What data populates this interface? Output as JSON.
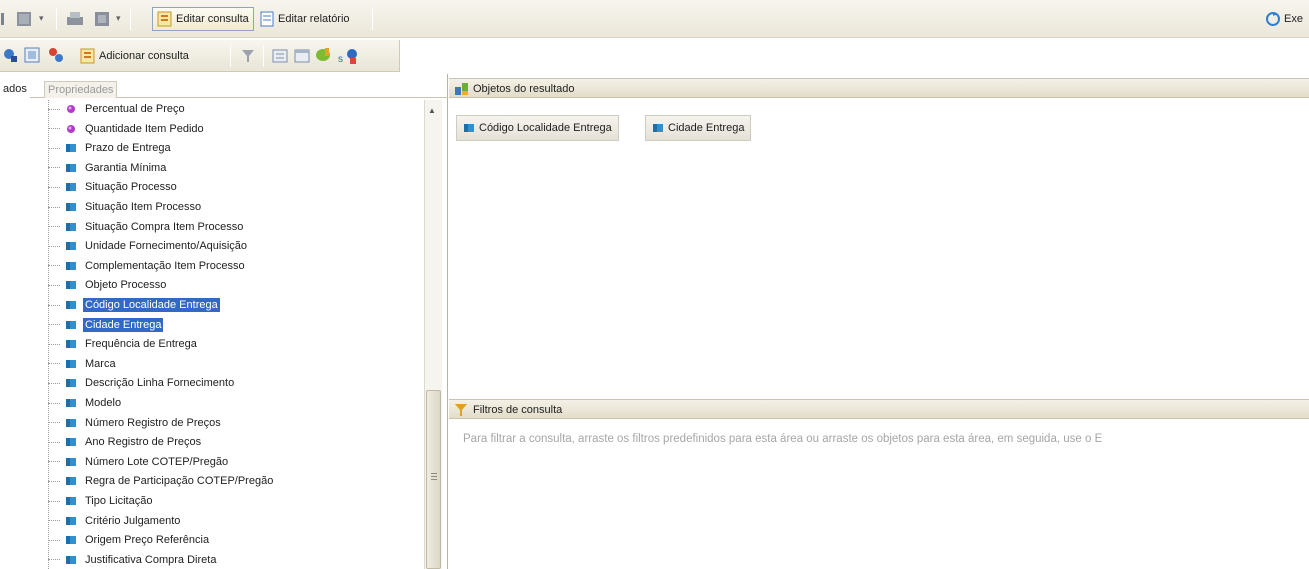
{
  "toolbar": {
    "edit_query_label": "Editar consulta",
    "edit_report_label": "Editar relatório",
    "execute_label": "Exe",
    "add_query_label": "Adicionar consulta"
  },
  "left_panel": {
    "tab_data": "ados",
    "tab_properties": "Propriedades",
    "items": [
      {
        "label": "Percentual de Preço",
        "icon": "measure-icon",
        "selected": false
      },
      {
        "label": "Quantidade Item Pedido",
        "icon": "measure-icon",
        "selected": false
      },
      {
        "label": "Prazo de Entrega",
        "icon": "dimension-icon",
        "selected": false
      },
      {
        "label": "Garantia Mínima",
        "icon": "dimension-icon",
        "selected": false
      },
      {
        "label": "Situação Processo",
        "icon": "dimension-icon",
        "selected": false
      },
      {
        "label": "Situação Item Processo",
        "icon": "dimension-icon",
        "selected": false
      },
      {
        "label": "Situação Compra Item Processo",
        "icon": "dimension-icon",
        "selected": false
      },
      {
        "label": "Unidade Fornecimento/Aquisição",
        "icon": "dimension-icon",
        "selected": false
      },
      {
        "label": "Complementação Item Processo",
        "icon": "dimension-icon",
        "selected": false
      },
      {
        "label": "Objeto Processo",
        "icon": "dimension-icon",
        "selected": false
      },
      {
        "label": "Código Localidade Entrega",
        "icon": "dimension-icon",
        "selected": true
      },
      {
        "label": "Cidade Entrega",
        "icon": "dimension-icon",
        "selected": true
      },
      {
        "label": "Frequência de Entrega",
        "icon": "dimension-icon",
        "selected": false
      },
      {
        "label": "Marca",
        "icon": "dimension-icon",
        "selected": false
      },
      {
        "label": "Descrição Linha Fornecimento",
        "icon": "dimension-icon",
        "selected": false
      },
      {
        "label": "Modelo",
        "icon": "dimension-icon",
        "selected": false
      },
      {
        "label": "Número Registro de Preços",
        "icon": "dimension-icon",
        "selected": false
      },
      {
        "label": "Ano Registro de Preços",
        "icon": "dimension-icon",
        "selected": false
      },
      {
        "label": "Número Lote COTEP/Pregão",
        "icon": "dimension-icon",
        "selected": false
      },
      {
        "label": "Regra de Participação COTEP/Pregão",
        "icon": "dimension-icon",
        "selected": false
      },
      {
        "label": "Tipo Licitação",
        "icon": "dimension-icon",
        "selected": false
      },
      {
        "label": "Critério Julgamento",
        "icon": "dimension-icon",
        "selected": false
      },
      {
        "label": "Origem Preço Referência",
        "icon": "dimension-icon",
        "selected": false
      },
      {
        "label": "Justificativa Compra Direta",
        "icon": "dimension-icon",
        "selected": false
      }
    ]
  },
  "result_panel": {
    "title": "Objetos do resultado",
    "objects": [
      {
        "label": "Código Localidade Entrega"
      },
      {
        "label": "Cidade Entrega"
      }
    ]
  },
  "filter_panel": {
    "title": "Filtros de consulta",
    "hint": "Para filtrar a consulta, arraste os filtros predefinidos para esta área ou arraste os objetos para esta área, em seguida, use o E"
  }
}
